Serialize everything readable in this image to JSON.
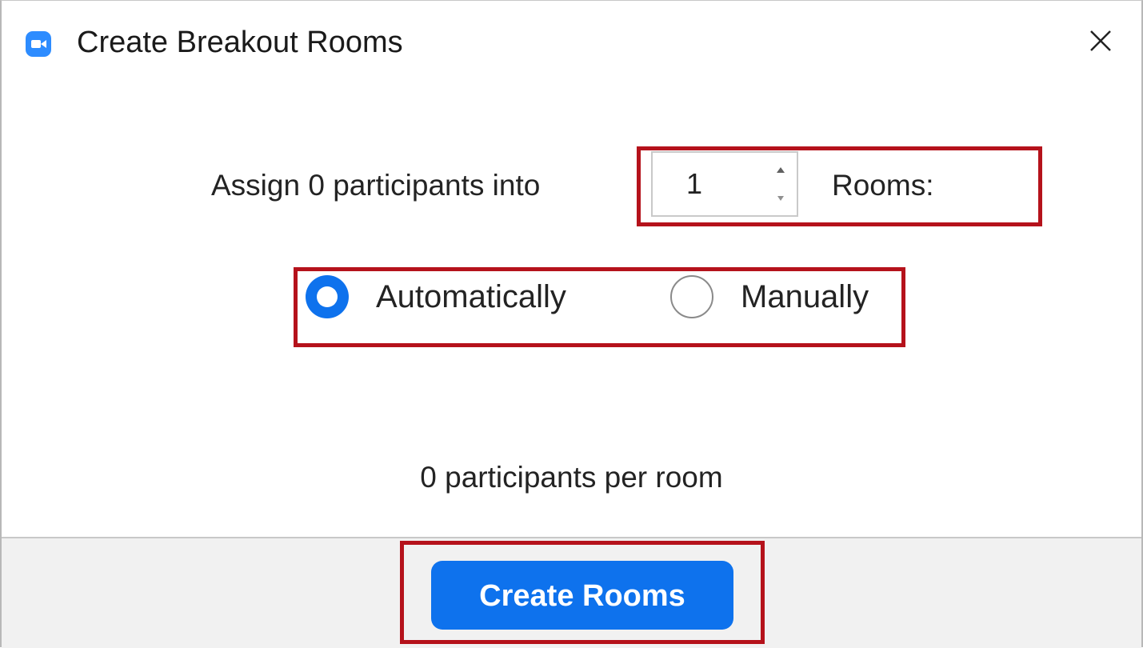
{
  "window": {
    "title": "Create Breakout Rooms",
    "app_icon": "zoom-camera-icon",
    "close_icon": "close-icon"
  },
  "assign": {
    "label": "Assign 0 participants into",
    "rooms_count": "1",
    "rooms_label": "Rooms:"
  },
  "assignment_mode": {
    "options": [
      {
        "label": "Automatically",
        "selected": true
      },
      {
        "label": "Manually",
        "selected": false
      }
    ]
  },
  "per_room_text": "0 participants per room",
  "footer": {
    "create_button_label": "Create Rooms"
  },
  "colors": {
    "accent": "#0e72ed",
    "app_icon": "#2d8cff",
    "highlight": "#b5121b",
    "footer_bg": "#f1f1f1"
  }
}
